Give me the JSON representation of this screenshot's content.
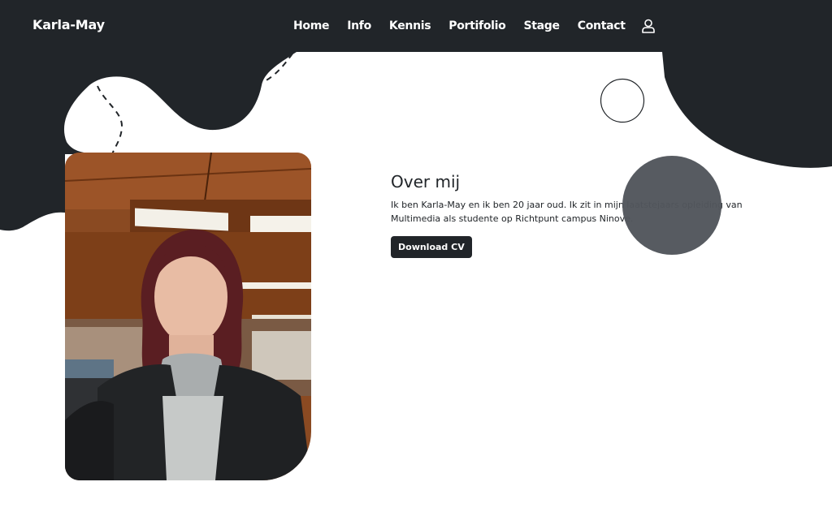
{
  "navbar": {
    "brand": "Karla-May",
    "links": [
      {
        "label": "Home"
      },
      {
        "label": "Info"
      },
      {
        "label": "Kennis"
      },
      {
        "label": "Portifolio"
      },
      {
        "label": "Stage"
      },
      {
        "label": "Contact"
      }
    ],
    "user_icon": "user-icon"
  },
  "about": {
    "title": "Over mij",
    "text": "Ik ben Karla-May en ik ben 20 jaar oud. Ik zit in mijn laatstejaars opleiding van Multimedia als studente op Richtpunt campus Ninove.",
    "button_label": "Download CV"
  },
  "colors": {
    "dark": "#212529",
    "accent_circle": "#52565c",
    "white": "#ffffff"
  }
}
